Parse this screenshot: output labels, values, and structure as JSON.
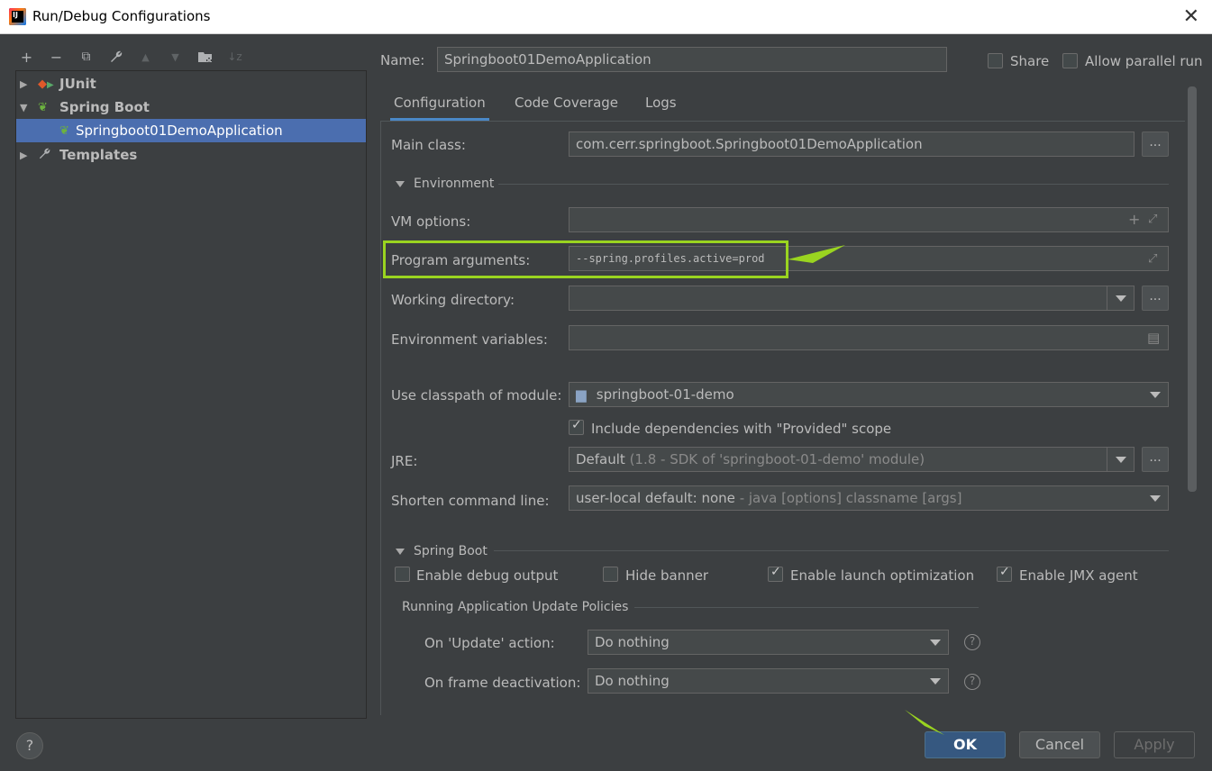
{
  "window": {
    "title": "Run/Debug Configurations",
    "app_icon_text": "IJ"
  },
  "toolbar": {
    "add": "+",
    "remove": "−",
    "copy": "⧉",
    "edit": "🔧",
    "move_up": "▲",
    "move_down": "▼",
    "folder": "📁",
    "sort": "↓z"
  },
  "tree": {
    "items": [
      {
        "label": "JUnit",
        "icon": "junit-icon",
        "expanded": false
      },
      {
        "label": "Spring Boot",
        "icon": "spring-boot-icon",
        "expanded": true
      },
      {
        "label": "Springboot01DemoApplication",
        "icon": "spring-boot-app-icon",
        "selected": true
      },
      {
        "label": "Templates",
        "icon": "wrench-icon",
        "expanded": false
      }
    ]
  },
  "name_row": {
    "label": "Name:",
    "value": "Springboot01DemoApplication"
  },
  "share": {
    "label": "Share",
    "checked": false
  },
  "parallel": {
    "label": "Allow parallel run",
    "checked": false
  },
  "tabs": [
    "Configuration",
    "Code Coverage",
    "Logs"
  ],
  "config": {
    "main_class": {
      "label": "Main class:",
      "value": "com.cerr.springboot.Springboot01DemoApplication"
    },
    "environment_section": "Environment",
    "vm_options": {
      "label": "VM options:",
      "value": ""
    },
    "program_arguments": {
      "label": "Program arguments:",
      "value": "--spring.profiles.active=prod"
    },
    "working_directory": {
      "label": "Working directory:",
      "value": ""
    },
    "env_variables": {
      "label": "Environment variables:",
      "value": ""
    },
    "classpath_module": {
      "label": "Use classpath of module:",
      "value": "springboot-01-demo"
    },
    "include_deps": {
      "label": "Include dependencies with \"Provided\" scope",
      "checked": true
    },
    "jre": {
      "label": "JRE:",
      "value": "Default",
      "value_dim": " (1.8 - SDK of 'springboot-01-demo' module)"
    },
    "shorten": {
      "label": "Shorten command line:",
      "value": "user-local default: none",
      "value_dim": " - java [options] classname [args]"
    },
    "spring_boot_section": "Spring Boot",
    "debug_output": {
      "label": "Enable debug output",
      "checked": false
    },
    "hide_banner": {
      "label": "Hide banner",
      "checked": false
    },
    "launch_opt": {
      "label": "Enable launch optimization",
      "checked": true
    },
    "jmx_agent": {
      "label": "Enable JMX agent",
      "checked": true
    },
    "update_policies_title": "Running Application Update Policies",
    "on_update": {
      "label": "On 'Update' action:",
      "value": "Do nothing"
    },
    "on_frame": {
      "label": "On frame deactivation:",
      "value": "Do nothing"
    }
  },
  "buttons": {
    "ok": "OK",
    "cancel": "Cancel",
    "apply": "Apply",
    "help": "?"
  },
  "colors": {
    "accent": "#4a88c7",
    "selection": "#4b6eaf",
    "highlight": "#9ad420",
    "primary_button": "#365880"
  }
}
